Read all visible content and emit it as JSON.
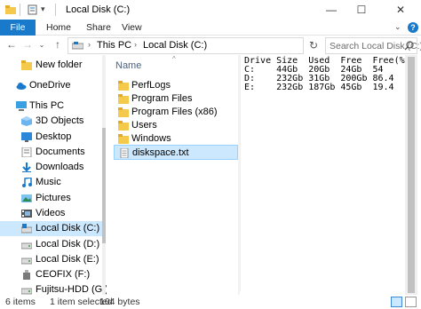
{
  "window": {
    "title": "Local Disk (C:)",
    "controls": {
      "minimize": "—",
      "maximize": "☐",
      "close": "✕"
    }
  },
  "ribbon": {
    "tabs": [
      "File",
      "Home",
      "Share",
      "View"
    ]
  },
  "address": {
    "segments": [
      "This PC",
      "Local Disk (C:)"
    ],
    "search_placeholder": "Search Local Disk (C:)"
  },
  "navigation_pane": {
    "items": [
      {
        "label": "New folder",
        "icon": "folder-icon"
      },
      {
        "label": "OneDrive",
        "icon": "cloud-icon"
      },
      {
        "label": "This PC",
        "icon": "computer-icon"
      },
      {
        "label": "3D Objects",
        "icon": "cube-icon"
      },
      {
        "label": "Desktop",
        "icon": "desktop-icon"
      },
      {
        "label": "Documents",
        "icon": "documents-icon"
      },
      {
        "label": "Downloads",
        "icon": "download-icon"
      },
      {
        "label": "Music",
        "icon": "music-icon"
      },
      {
        "label": "Pictures",
        "icon": "pictures-icon"
      },
      {
        "label": "Videos",
        "icon": "videos-icon"
      },
      {
        "label": "Local Disk (C:)",
        "icon": "drive-icon",
        "selected": true
      },
      {
        "label": "Local Disk (D:)",
        "icon": "drive-icon"
      },
      {
        "label": "Local Disk (E:)",
        "icon": "drive-icon"
      },
      {
        "label": "CEOFIX (F:)",
        "icon": "usb-drive-icon"
      },
      {
        "label": "Fujitsu-HDD (G:)",
        "icon": "drive-icon"
      }
    ]
  },
  "file_list": {
    "column_header": "Name",
    "items": [
      {
        "name": "PerfLogs",
        "type": "folder"
      },
      {
        "name": "Program Files",
        "type": "folder"
      },
      {
        "name": "Program Files (x86)",
        "type": "folder"
      },
      {
        "name": "Users",
        "type": "folder"
      },
      {
        "name": "Windows",
        "type": "folder"
      },
      {
        "name": "diskspace.txt",
        "type": "text-file",
        "selected": true
      }
    ]
  },
  "preview": {
    "lines": [
      "Drive Size  Used  Free  Free(%)",
      "C:    44Gb  20Gb  24Gb  54",
      "D:    232Gb 31Gb  200Gb 86.4",
      "E:    232Gb 187Gb 45Gb  19.4"
    ]
  },
  "status": {
    "item_count": "6 items",
    "selected": "1 item selected",
    "size": "104 bytes"
  },
  "colors": {
    "accent": "#1979ca",
    "selection": "#cce8ff",
    "folder": "#f5c94c"
  }
}
